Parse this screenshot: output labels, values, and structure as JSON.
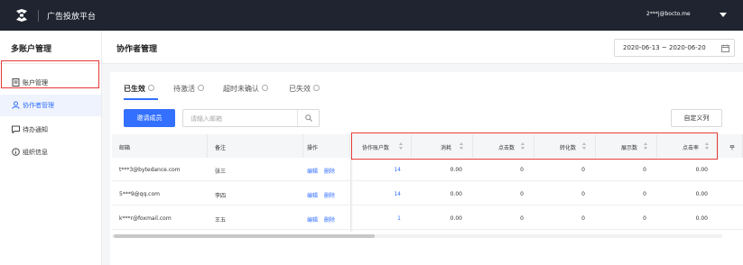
{
  "topbar": {
    "brand": "广告投放平台",
    "user": "2***j@bocto.me",
    "logo_icon": "logo-icon",
    "caret_icon": "chevron-down-icon"
  },
  "sidebar": {
    "title": "多账户管理",
    "items": [
      {
        "label": "账户管理",
        "icon": "document-icon"
      },
      {
        "label": "协作者管理",
        "icon": "user-icon",
        "active": true
      },
      {
        "label": "待办通知",
        "icon": "message-icon"
      },
      {
        "label": "组织信息",
        "icon": "info-icon"
      }
    ]
  },
  "header": {
    "title": "协作者管理",
    "date_range": "2020-06-13 ~ 2020-06-20"
  },
  "tabs": [
    {
      "label": "已生效",
      "active": true
    },
    {
      "label": "待激活"
    },
    {
      "label": "超时未确认"
    },
    {
      "label": "已失效"
    }
  ],
  "toolbar": {
    "invite_label": "邀请成员",
    "search_placeholder": "请输入邮箱",
    "custom_columns_label": "自定义列"
  },
  "table": {
    "columns": [
      "邮箱",
      "备注",
      "操作",
      "协作账户数",
      "消耗",
      "点击数",
      "转化数",
      "展示数",
      "点击率",
      "平"
    ],
    "rows": [
      {
        "email": "t***3@bytedance.com",
        "note": "张三",
        "edit": "编辑",
        "delete": "删除",
        "accounts": "14",
        "cost": "0.00",
        "clicks": "0",
        "conversions": "0",
        "impressions": "0",
        "ctr": "0.00"
      },
      {
        "email": "5***9@qq.com",
        "note": "李四",
        "edit": "编辑",
        "delete": "删除",
        "accounts": "14",
        "cost": "0.00",
        "clicks": "0",
        "conversions": "0",
        "impressions": "0",
        "ctr": "0.00"
      },
      {
        "email": "k***r@foxmail.com",
        "note": "王五",
        "edit": "编辑",
        "delete": "删除",
        "accounts": "1",
        "cost": "0.00",
        "clicks": "0",
        "conversions": "0",
        "impressions": "0",
        "ctr": "0.00"
      }
    ]
  },
  "colors": {
    "accent": "#3370ff",
    "highlight": "#e53935",
    "topbar": "#1f2430"
  }
}
